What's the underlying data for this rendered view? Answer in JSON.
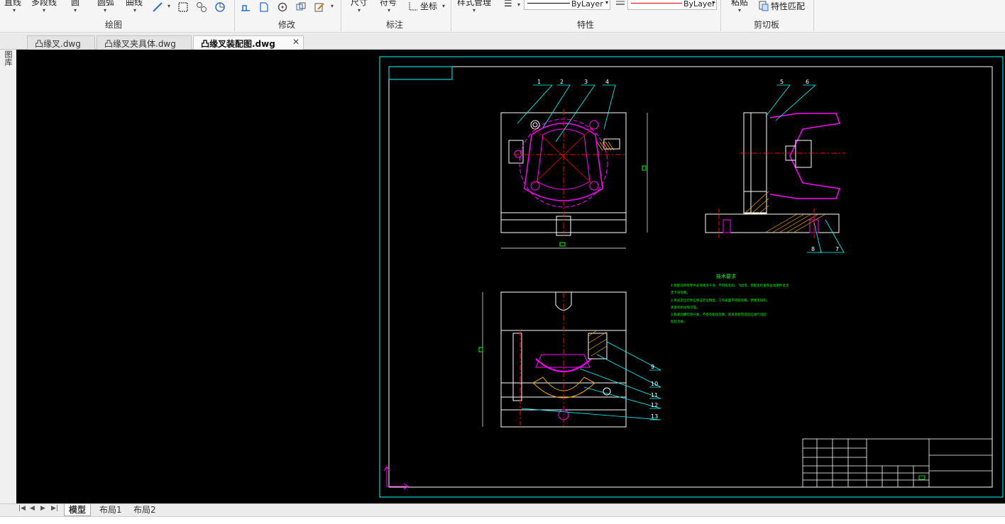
{
  "ribbon": {
    "draw_group": {
      "title": "绘图",
      "items": [
        "直线",
        "多段线",
        "圆",
        "圆弧",
        "曲线"
      ]
    },
    "modify_group": {
      "title": "修改"
    },
    "annotate_group": {
      "title": "标注",
      "items": [
        "尺寸",
        "符号",
        "坐标"
      ]
    },
    "properties_group": {
      "title": "特性",
      "style_label": "样式管理",
      "linetype_value": "ByLayer",
      "color_value": "ByLayer"
    },
    "clipboard_group": {
      "title": "剪切板",
      "paste_label": "粘贴",
      "match_label": "特性匹配"
    }
  },
  "tabs": [
    {
      "label": "凸缘叉.dwg"
    },
    {
      "label": "凸缘叉夹具体.dwg"
    },
    {
      "label": "凸缘叉装配图.dwg",
      "active": true
    }
  ],
  "left_toolbar": {
    "label": "图库"
  },
  "layout_tabs": [
    "模型",
    "布局1",
    "布局2"
  ],
  "drawing": {
    "part_numbers": [
      "1",
      "2",
      "3",
      "4",
      "5",
      "6",
      "7",
      "8",
      "9",
      "10",
      "11",
      "12",
      "13"
    ],
    "tech_title": "技术要求",
    "tech_lines": [
      "1.装配前所有零件必须清洗干净，不得有毛刺、飞边等。装配后检查各运动部件灵活",
      "无卡滞现象。",
      "2.夹具定位元件应保证定位精度，工作表面不得有划痕、锈蚀等缺陷，",
      "夹紧机构动作可靠。",
      "3.各紧固螺钉须拧紧，不得有松动现象。夹具装配完成后应进行试验",
      "检验合格。"
    ]
  },
  "colors": {
    "canvas_bg": "#000000",
    "frame": "#00ffff",
    "geometry": "#ffffff",
    "part": "#ff00ff",
    "center": "#ff0000",
    "text": "#00ff00",
    "leader": "#00ffff"
  }
}
